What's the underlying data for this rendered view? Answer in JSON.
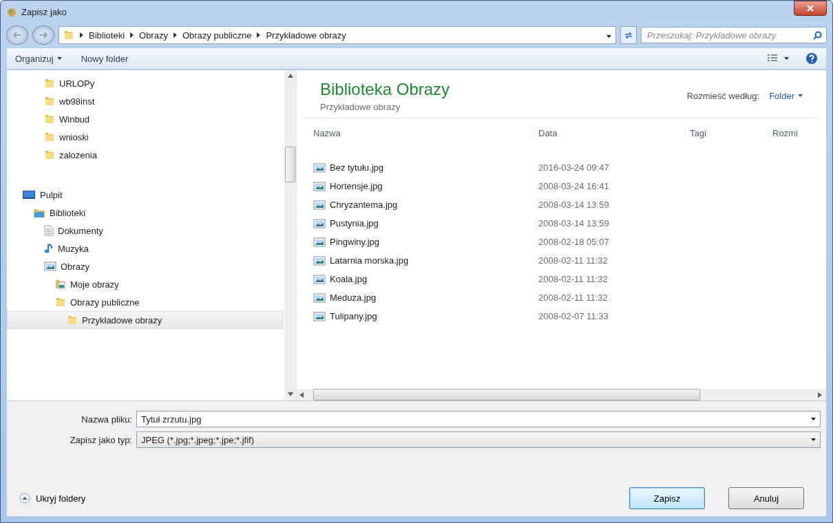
{
  "window": {
    "title": "Zapisz jako"
  },
  "address": {
    "crumbs": [
      "Biblioteki",
      "Obrazy",
      "Obrazy publiczne",
      "Przykładowe obrazy"
    ],
    "search_placeholder": "Przeszukaj: Przykładowe obrazy"
  },
  "toolbar": {
    "organize": "Organizuj",
    "new_folder": "Nowy folder"
  },
  "nav_tree": {
    "partial_items": [
      {
        "label": "URLOPy",
        "kind": "folder",
        "selected": false
      },
      {
        "label": "wb98inst",
        "kind": "folder",
        "selected": false
      },
      {
        "label": "Winbud",
        "kind": "folder",
        "selected": false
      },
      {
        "label": "wnioski",
        "kind": "folder",
        "selected": false
      },
      {
        "label": "zalozenia",
        "kind": "folder",
        "selected": false
      }
    ],
    "items": [
      {
        "label": "Pulpit",
        "kind": "desktop",
        "selected": false,
        "children": [
          {
            "label": "Biblioteki",
            "kind": "libraries",
            "selected": false,
            "children": [
              {
                "label": "Dokumenty",
                "kind": "document",
                "selected": false
              },
              {
                "label": "Muzyka",
                "kind": "music",
                "selected": false
              },
              {
                "label": "Obrazy",
                "kind": "pictures",
                "selected": false,
                "children": [
                  {
                    "label": "Moje obrazy",
                    "kind": "picture-folder",
                    "selected": false
                  },
                  {
                    "label": "Obrazy publiczne",
                    "kind": "folder",
                    "selected": false,
                    "children": [
                      {
                        "label": "Przykładowe obrazy",
                        "kind": "folder",
                        "selected": true
                      }
                    ]
                  }
                ]
              }
            ]
          }
        ]
      }
    ]
  },
  "library": {
    "title": "Biblioteka Obrazy",
    "subtitle": "Przykładowe obrazy",
    "arrange_label": "Rozmieść według:",
    "arrange_value": "Folder"
  },
  "files": {
    "columns": [
      "Nazwa",
      "Data",
      "Tagi",
      "Rozmi"
    ],
    "rows": [
      {
        "name": "Bez tytułu.jpg",
        "date": "2016-03-24 09:47"
      },
      {
        "name": "Hortensje.jpg",
        "date": "2008-03-24 16:41"
      },
      {
        "name": "Chryzantema.jpg",
        "date": "2008-03-14 13:59"
      },
      {
        "name": "Pustynia.jpg",
        "date": "2008-03-14 13:59"
      },
      {
        "name": "Pingwiny.jpg",
        "date": "2008-02-18 05:07"
      },
      {
        "name": "Latarnia morska.jpg",
        "date": "2008-02-11 11:32"
      },
      {
        "name": "Koala.jpg",
        "date": "2008-02-11 11:32"
      },
      {
        "name": "Meduza.jpg",
        "date": "2008-02-11 11:32"
      },
      {
        "name": "Tulipany.jpg",
        "date": "2008-02-07 11:33"
      }
    ]
  },
  "form": {
    "filename_label": "Nazwa pliku:",
    "filename": "Tytuł zrzutu.jpg",
    "type_label": "Zapisz jako typ:",
    "type": "JPEG (*.jpg;*.jpeg;*.jpe;*.jfif)"
  },
  "hide_folders": "Ukryj foldery",
  "buttons": [
    {
      "label": "Zapisz",
      "kind": "primary"
    },
    {
      "label": "Anuluj",
      "kind": "normal"
    }
  ]
}
